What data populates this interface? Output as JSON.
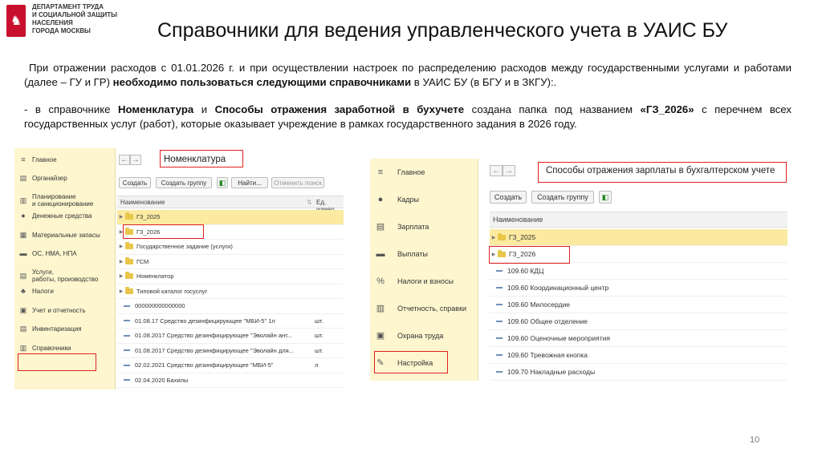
{
  "header": {
    "dept_lines": [
      "Департамент труда",
      "и социальной защиты",
      "населения",
      "города Москвы"
    ],
    "title": "Справочники для ведения управленческого учета в УАИС БУ"
  },
  "para1": {
    "t1": "При отражении расходов с 01.01.2026 г. и при осуществлении настроек по распределению расходов между государственными услугами и работами (далее – ГУ и ГР) ",
    "t2": "необходимо пользоваться следующими справочниками",
    "t3": " в УАИС БУ (в БГУ и в ЗКГУ):."
  },
  "para2": {
    "t1": "- в справочнике ",
    "t2": "Номенклатура",
    "t3": " и ",
    "t4": "Способы отражения заработной в бухучете",
    "t5": " создана папка под названием ",
    "t6": "«ГЗ_2026»",
    "t7": " с перечнем всех государственных услуг (работ), которые оказывает учреждение в рамках государственного задания в 2026 году."
  },
  "shot1": {
    "sidebar": [
      {
        "icon": "menu-icon",
        "glyph": "≡",
        "label": "Главное"
      },
      {
        "icon": "organizer-icon",
        "glyph": "▤",
        "label": "Органайзер"
      },
      {
        "icon": "planning-icon",
        "glyph": "▥",
        "label": "Планирование\nи санкционирование"
      },
      {
        "icon": "money-icon",
        "glyph": "●",
        "label": "Денежные средства"
      },
      {
        "icon": "materials-icon",
        "glyph": "▦",
        "label": "Материальные запасы"
      },
      {
        "icon": "assets-icon",
        "glyph": "▬",
        "label": "ОС, НМА, НПА"
      },
      {
        "icon": "services-icon",
        "glyph": "▤",
        "label": "Услуги,\nработы, производство"
      },
      {
        "icon": "taxes-icon",
        "glyph": "♣",
        "label": "Налоги"
      },
      {
        "icon": "reporting-icon",
        "glyph": "▣",
        "label": "Учет и отчетность"
      },
      {
        "icon": "inventory-icon",
        "glyph": "▤",
        "label": "Инвентаризация"
      },
      {
        "icon": "reference-icon",
        "glyph": "▥",
        "label": "Справочники"
      }
    ],
    "window_title": "Номенклатура",
    "buttons": {
      "create": "Создать",
      "create_group": "Создать группу",
      "find": "Найти...",
      "cancel_search": "Отменить поиск"
    },
    "columns": {
      "name": "Наименование",
      "unit": "Ед. измер"
    },
    "rows": [
      {
        "type": "folder",
        "name": "ГЗ_2025",
        "unit": "",
        "selected": true
      },
      {
        "type": "folder",
        "name": "ГЗ_2026",
        "unit": "",
        "selected": false
      },
      {
        "type": "folder",
        "name": "Государственное задание (услуги)",
        "unit": "",
        "selected": false
      },
      {
        "type": "folder",
        "name": "ГСМ",
        "unit": "",
        "selected": false
      },
      {
        "type": "folder",
        "name": "Номенклатор",
        "unit": "",
        "selected": false
      },
      {
        "type": "folder",
        "name": "Типовой каталог госуслуг",
        "unit": "",
        "selected": false
      },
      {
        "type": "item",
        "name": "000000000000000",
        "unit": "",
        "selected": false
      },
      {
        "type": "item",
        "name": "01.08.17 Средство дезинфицирующее \"МБИ-5\" 1л",
        "unit": "шт.",
        "selected": false
      },
      {
        "type": "item",
        "name": "01.08.2017 Средство дезинфицирующее \"Эволайн ант...",
        "unit": "шт.",
        "selected": false
      },
      {
        "type": "item",
        "name": "01.08.2017 Средство дезинфицирующее \"Эволайн для...",
        "unit": "шт.",
        "selected": false
      },
      {
        "type": "item",
        "name": "02.02.2021 Средство дезинфицирующее \"МБИ-5\"",
        "unit": "л",
        "selected": false
      },
      {
        "type": "item",
        "name": "02.04.2020 Бахилы",
        "unit": "",
        "selected": false
      }
    ]
  },
  "shot2": {
    "sidebar": [
      {
        "icon": "menu-icon",
        "glyph": "≡",
        "label": "Главное"
      },
      {
        "icon": "staff-icon",
        "glyph": "●",
        "label": "Кадры"
      },
      {
        "icon": "salary-icon",
        "glyph": "▤",
        "label": "Зарплата"
      },
      {
        "icon": "payments-icon",
        "glyph": "▬",
        "label": "Выплаты"
      },
      {
        "icon": "percent-icon",
        "glyph": "%",
        "label": "Налоги и взносы"
      },
      {
        "icon": "reports-icon",
        "glyph": "▥",
        "label": "Отчетность, справки"
      },
      {
        "icon": "safety-icon",
        "glyph": "▣",
        "label": "Охрана труда"
      },
      {
        "icon": "wrench-icon",
        "glyph": "✎",
        "label": "Настройка"
      }
    ],
    "window_title": "Способы отражения зарплаты в бухгалтерском учете",
    "buttons": {
      "create": "Создать",
      "create_group": "Создать группу"
    },
    "columns": {
      "name": "Наименование"
    },
    "rows": [
      {
        "type": "folder",
        "name": "ГЗ_2025",
        "selected": true
      },
      {
        "type": "folder",
        "name": "ГЗ_2026",
        "selected": false
      },
      {
        "type": "item",
        "name": "109.60 КДЦ",
        "selected": false
      },
      {
        "type": "item",
        "name": "109.60 Координационный центр",
        "selected": false
      },
      {
        "type": "item",
        "name": "109.60 Милосердие",
        "selected": false
      },
      {
        "type": "item",
        "name": "109.60 Общее отделение",
        "selected": false
      },
      {
        "type": "item",
        "name": "109.60 Оценочные мероприятия",
        "selected": false
      },
      {
        "type": "item",
        "name": "109.60 Тревожная кнопка",
        "selected": false
      },
      {
        "type": "item",
        "name": "109.70 Накладные расходы",
        "selected": false
      }
    ]
  },
  "footer": {
    "page_number": "10"
  },
  "colors": {
    "highlight_red": "#e02020",
    "sidebar_bg": "#fdf6cf",
    "selected_row": "#fbeaa0",
    "folder": "#e8c64a"
  }
}
